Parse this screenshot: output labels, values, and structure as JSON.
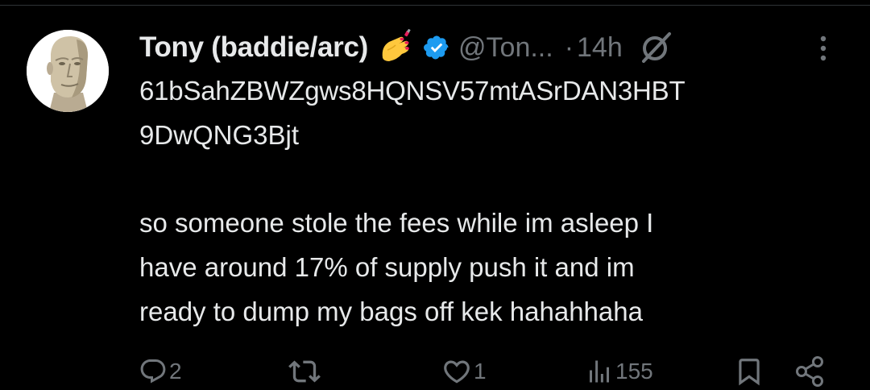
{
  "tweet": {
    "display_name": "Tony (baddie/arc)",
    "handle": "@Ton...",
    "separator": "·",
    "time": "14h",
    "content_line1": "61bSahZBWZgws8HQNSV57mtASrDAN3HBT",
    "content_line2": "9DwQNG3Bjt",
    "content_paragraph": "so someone stole the fees while im asleep I\nhave around 17% of supply push it and im\nready to dump my bags off kek hahahhaha"
  },
  "actions": {
    "reply_count": "2",
    "repost_count": "",
    "like_count": "1",
    "views_count": "155"
  },
  "icons": {
    "avatar": "meme-man-avatar",
    "emoji": "nail-polish-emoji",
    "verified": "verified-badge-icon",
    "grok": "grok-icon",
    "more": "more-options-icon",
    "reply": "reply-icon",
    "repost": "repost-icon",
    "like": "like-icon",
    "views": "views-icon",
    "bookmark": "bookmark-icon",
    "share": "share-icon"
  },
  "colors": {
    "background": "#000000",
    "text": "#e7e9ea",
    "muted": "#71767b",
    "verified": "#1d9bf0"
  }
}
